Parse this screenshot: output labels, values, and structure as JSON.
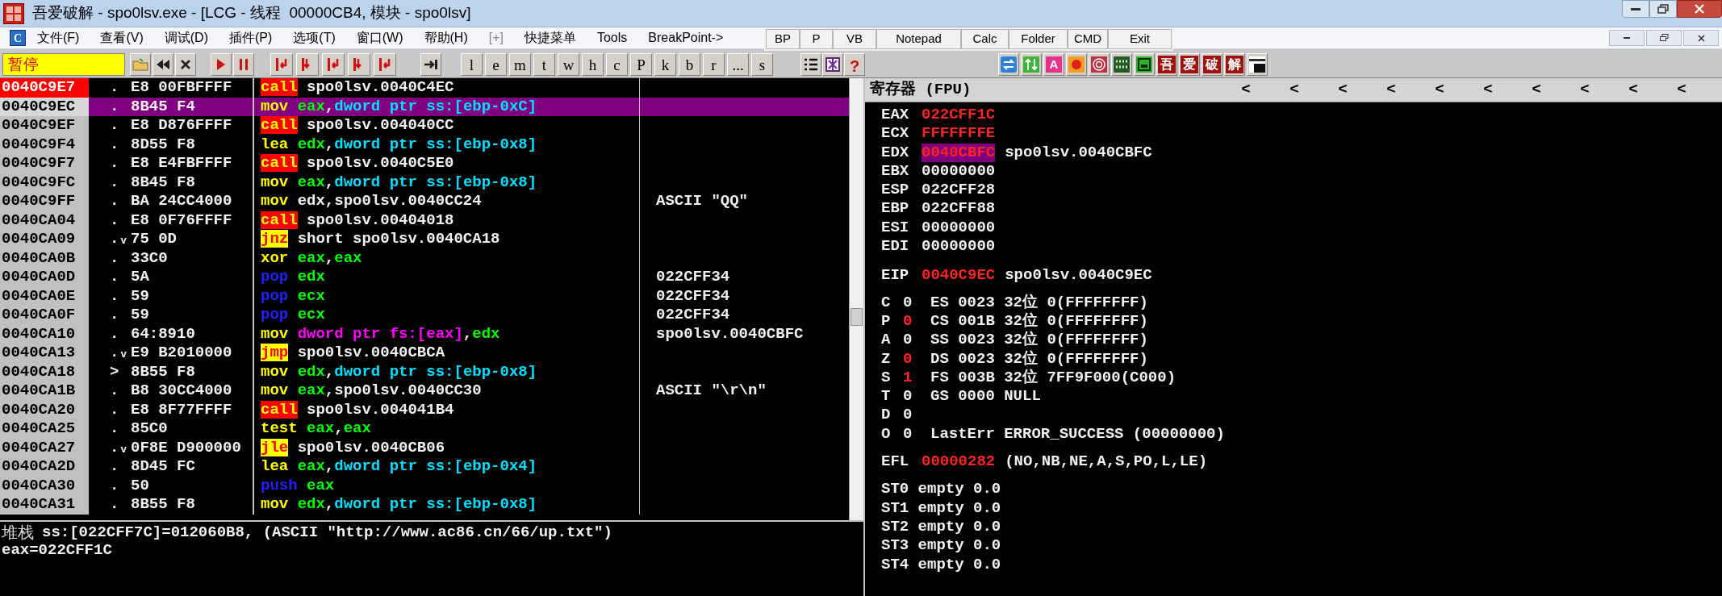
{
  "window": {
    "title": "吾爱破解 - spo0lsv.exe - [LCG - 线程  00000CB4, 模块 - spo0lsv]"
  },
  "menu": {
    "icon_letter": "C",
    "items": [
      {
        "label": "文件(F)",
        "disabled": false
      },
      {
        "label": "查看(V)",
        "disabled": false
      },
      {
        "label": "调试(D)",
        "disabled": false
      },
      {
        "label": "插件(P)",
        "disabled": false
      },
      {
        "label": "选项(T)",
        "disabled": false
      },
      {
        "label": "窗口(W)",
        "disabled": false
      },
      {
        "label": "帮助(H)",
        "disabled": false
      },
      {
        "label": "[+]",
        "disabled": true
      },
      {
        "label": "快捷菜单",
        "disabled": false
      },
      {
        "label": "Tools",
        "disabled": false
      },
      {
        "label": "BreakPoint->",
        "disabled": false
      }
    ]
  },
  "quick_buttons": [
    "BP",
    "P",
    "VB",
    "Notepad",
    "Calc",
    "Folder",
    "CMD",
    "Exit"
  ],
  "toolbar": {
    "status": "暂停",
    "letter_buttons": [
      "l",
      "e",
      "m",
      "t",
      "w",
      "h",
      "c",
      "P",
      "k",
      "b",
      "r",
      "...",
      "s"
    ],
    "help": "?",
    "font_button": "A",
    "brand_buttons": [
      "吾",
      "爱",
      "破",
      "解"
    ]
  },
  "disasm": {
    "rows": [
      {
        "address": "0040C9E7",
        "marker": ".",
        "hex": "E8 00FBFFFF",
        "op": "call",
        "kind": "call",
        "args": [
          {
            "kind": "text",
            "text": "spo0lsv.0040C4EC"
          }
        ],
        "selected": false,
        "breakpoint": true
      },
      {
        "address": "0040C9EC",
        "marker": ".",
        "hex": "8B45 F4",
        "op": "mov",
        "kind": "plain",
        "args": [
          {
            "kind": "reg",
            "text": "eax"
          },
          {
            "kind": "text",
            "text": ","
          },
          {
            "kind": "mem",
            "text": "dword ptr ss:[ebp-0xC]"
          }
        ],
        "selected": true,
        "breakpoint": false
      },
      {
        "address": "0040C9EF",
        "marker": ".",
        "hex": "E8 D876FFFF",
        "op": "call",
        "kind": "call",
        "args": [
          {
            "kind": "text",
            "text": "spo0lsv.004040CC"
          }
        ],
        "selected": false,
        "breakpoint": false
      },
      {
        "address": "0040C9F4",
        "marker": ".",
        "hex": "8D55 F8",
        "op": "lea",
        "kind": "plain",
        "args": [
          {
            "kind": "reg",
            "text": "edx"
          },
          {
            "kind": "text",
            "text": ","
          },
          {
            "kind": "mem",
            "text": "dword ptr ss:[ebp-0x8]"
          }
        ],
        "selected": false,
        "breakpoint": false
      },
      {
        "address": "0040C9F7",
        "marker": ".",
        "hex": "E8 E4FBFFFF",
        "op": "call",
        "kind": "call",
        "args": [
          {
            "kind": "text",
            "text": "spo0lsv.0040C5E0"
          }
        ],
        "selected": false,
        "breakpoint": false
      },
      {
        "address": "0040C9FC",
        "marker": ".",
        "hex": "8B45 F8",
        "op": "mov",
        "kind": "plain",
        "args": [
          {
            "kind": "reg",
            "text": "eax"
          },
          {
            "kind": "text",
            "text": ","
          },
          {
            "kind": "mem",
            "text": "dword ptr ss:[ebp-0x8]"
          }
        ],
        "selected": false,
        "breakpoint": false
      },
      {
        "address": "0040C9FF",
        "marker": ".",
        "hex": "BA 24CC4000",
        "op": "mov",
        "kind": "plain",
        "args": [
          {
            "kind": "text",
            "text": "edx,spo0lsv.0040CC24"
          }
        ],
        "comment": "ASCII \"QQ\"",
        "selected": false,
        "breakpoint": false
      },
      {
        "address": "0040CA04",
        "marker": ".",
        "hex": "E8 0F76FFFF",
        "op": "call",
        "kind": "call",
        "args": [
          {
            "kind": "text",
            "text": "spo0lsv.00404018"
          }
        ],
        "selected": false,
        "breakpoint": false
      },
      {
        "address": "0040CA09",
        "marker": ".ᵥ",
        "hex": "75 0D",
        "op": "jnz",
        "kind": "jump",
        "args": [
          {
            "kind": "text",
            "text": "short spo0lsv.0040CA18"
          }
        ],
        "selected": false,
        "breakpoint": false
      },
      {
        "address": "0040CA0B",
        "marker": ".",
        "hex": "33C0",
        "op": "xor",
        "kind": "plain",
        "args": [
          {
            "kind": "reg",
            "text": "eax"
          },
          {
            "kind": "text",
            "text": ","
          },
          {
            "kind": "reg",
            "text": "eax"
          }
        ],
        "selected": false,
        "breakpoint": false
      },
      {
        "address": "0040CA0D",
        "marker": ".",
        "hex": "5A",
        "op": "pop",
        "kind": "stack",
        "args": [
          {
            "kind": "reg",
            "text": "edx"
          }
        ],
        "comment": "022CFF34",
        "selected": false,
        "breakpoint": false
      },
      {
        "address": "0040CA0E",
        "marker": ".",
        "hex": "59",
        "op": "pop",
        "kind": "stack",
        "args": [
          {
            "kind": "reg",
            "text": "ecx"
          }
        ],
        "comment": "022CFF34",
        "selected": false,
        "breakpoint": false
      },
      {
        "address": "0040CA0F",
        "marker": ".",
        "hex": "59",
        "op": "pop",
        "kind": "stack",
        "args": [
          {
            "kind": "reg",
            "text": "ecx"
          }
        ],
        "comment": "022CFF34",
        "selected": false,
        "breakpoint": false
      },
      {
        "address": "0040CA10",
        "marker": ".",
        "hex": "64:8910",
        "op": "mov",
        "kind": "plain",
        "args": [
          {
            "kind": "segmem",
            "text": "dword ptr fs:[eax]"
          },
          {
            "kind": "text",
            "text": ","
          },
          {
            "kind": "reg",
            "text": "edx"
          }
        ],
        "comment": "spo0lsv.0040CBFC",
        "selected": false,
        "breakpoint": false
      },
      {
        "address": "0040CA13",
        "marker": ".ᵥ",
        "hex": "E9 B2010000",
        "op": "jmp",
        "kind": "jump",
        "args": [
          {
            "kind": "text",
            "text": "spo0lsv.0040CBCA"
          }
        ],
        "selected": false,
        "breakpoint": false
      },
      {
        "address": "0040CA18",
        "marker": ">",
        "hex": "8B55 F8",
        "op": "mov",
        "kind": "plain",
        "args": [
          {
            "kind": "reg",
            "text": "edx"
          },
          {
            "kind": "text",
            "text": ","
          },
          {
            "kind": "mem",
            "text": "dword ptr ss:[ebp-0x8]"
          }
        ],
        "selected": false,
        "breakpoint": false
      },
      {
        "address": "0040CA1B",
        "marker": ".",
        "hex": "B8 30CC4000",
        "op": "mov",
        "kind": "plain",
        "args": [
          {
            "kind": "reg",
            "text": "eax"
          },
          {
            "kind": "text",
            "text": ",spo0lsv.0040CC30"
          }
        ],
        "comment": "ASCII \"\\r\\n\"",
        "selected": false,
        "breakpoint": false
      },
      {
        "address": "0040CA20",
        "marker": ".",
        "hex": "E8 8F77FFFF",
        "op": "call",
        "kind": "call",
        "args": [
          {
            "kind": "text",
            "text": "spo0lsv.004041B4"
          }
        ],
        "selected": false,
        "breakpoint": false
      },
      {
        "address": "0040CA25",
        "marker": ".",
        "hex": "85C0",
        "op": "test",
        "kind": "plain",
        "args": [
          {
            "kind": "reg",
            "text": "eax"
          },
          {
            "kind": "text",
            "text": ","
          },
          {
            "kind": "reg",
            "text": "eax"
          }
        ],
        "selected": false,
        "breakpoint": false
      },
      {
        "address": "0040CA27",
        "marker": ".ᵥ",
        "hex": "0F8E D900000",
        "op": "jle",
        "kind": "jump",
        "args": [
          {
            "kind": "text",
            "text": "spo0lsv.0040CB06"
          }
        ],
        "selected": false,
        "breakpoint": false
      },
      {
        "address": "0040CA2D",
        "marker": ".",
        "hex": "8D45 FC",
        "op": "lea",
        "kind": "plain",
        "args": [
          {
            "kind": "reg",
            "text": "eax"
          },
          {
            "kind": "text",
            "text": ","
          },
          {
            "kind": "mem",
            "text": "dword ptr ss:[ebp-0x4]"
          }
        ],
        "selected": false,
        "breakpoint": false
      },
      {
        "address": "0040CA30",
        "marker": ".",
        "hex": "50",
        "op": "push",
        "kind": "stack",
        "args": [
          {
            "kind": "reg",
            "text": "eax"
          }
        ],
        "selected": false,
        "breakpoint": false
      },
      {
        "address": "0040CA31",
        "marker": ".",
        "hex": "8B55 F8",
        "op": "mov",
        "kind": "plain",
        "args": [
          {
            "kind": "reg",
            "text": "edx"
          },
          {
            "kind": "text",
            "text": ","
          },
          {
            "kind": "mem",
            "text": "dword ptr ss:[ebp-0x8]"
          }
        ],
        "selected": false,
        "breakpoint": false
      }
    ]
  },
  "info": {
    "label": "堆栈",
    "lines": [
      "ss:[022CFF7C]=012060B8, (ASCII \"http://www.ac86.cn/66/up.txt\")",
      "eax=022CFF1C"
    ]
  },
  "registers": {
    "title": "寄存器 (FPU)",
    "arrows": [
      "<",
      "<",
      "<",
      "<",
      "<",
      "<",
      "<",
      "<",
      "<",
      "<"
    ],
    "general": [
      {
        "name": "EAX",
        "value": "022CFF1C",
        "changed": true,
        "selected": false
      },
      {
        "name": "ECX",
        "value": "FFFFFFFE",
        "changed": true,
        "selected": false
      },
      {
        "name": "EDX",
        "value": "0040CBFC",
        "changed": true,
        "selected": true,
        "comment": "spo0lsv.0040CBFC"
      },
      {
        "name": "EBX",
        "value": "00000000",
        "changed": false,
        "selected": false
      },
      {
        "name": "ESP",
        "value": "022CFF28",
        "changed": false,
        "selected": false
      },
      {
        "name": "EBP",
        "value": "022CFF88",
        "changed": false,
        "selected": false
      },
      {
        "name": "ESI",
        "value": "00000000",
        "changed": false,
        "selected": false
      },
      {
        "name": "EDI",
        "value": "00000000",
        "changed": false,
        "selected": false
      }
    ],
    "eip": {
      "name": "EIP",
      "value": "0040C9EC",
      "changed": true,
      "comment": "spo0lsv.0040C9EC"
    },
    "flags": [
      {
        "name": "C",
        "value": "0",
        "changed": false,
        "detail": "ES 0023 32位 0(FFFFFFFF)"
      },
      {
        "name": "P",
        "value": "0",
        "changed": true,
        "detail": "CS 001B 32位 0(FFFFFFFF)"
      },
      {
        "name": "A",
        "value": "0",
        "changed": false,
        "detail": "SS 0023 32位 0(FFFFFFFF)"
      },
      {
        "name": "Z",
        "value": "0",
        "changed": true,
        "detail": "DS 0023 32位 0(FFFFFFFF)"
      },
      {
        "name": "S",
        "value": "1",
        "changed": true,
        "detail": "FS 003B 32位 7FF9F000(C000)"
      },
      {
        "name": "T",
        "value": "0",
        "changed": false,
        "detail": "GS 0000 NULL"
      },
      {
        "name": "D",
        "value": "0",
        "changed": false
      },
      {
        "name": "O",
        "value": "0",
        "changed": false,
        "detail": "LastErr ERROR_SUCCESS (00000000)"
      }
    ],
    "efl": {
      "name": "EFL",
      "value": "00000282",
      "changed": true,
      "detail": "(NO,NB,NE,A,S,PO,L,LE)"
    },
    "fpu": [
      "ST0 empty 0.0",
      "ST1 empty 0.0",
      "ST2 empty 0.0",
      "ST3 empty 0.0",
      "ST4 empty 0.0"
    ]
  }
}
